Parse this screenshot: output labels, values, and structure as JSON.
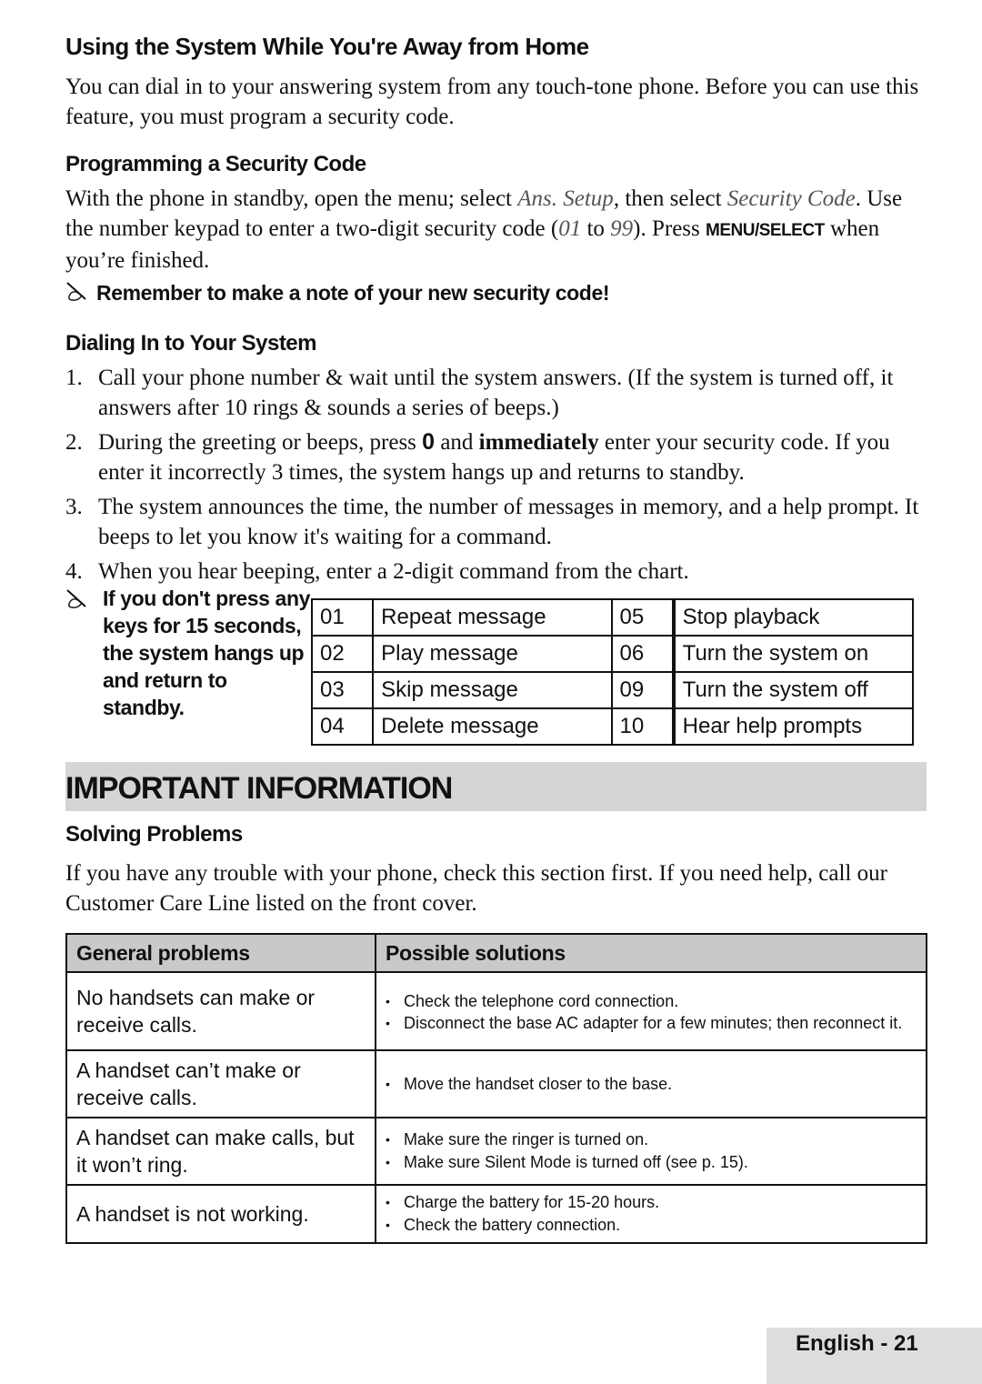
{
  "section1": {
    "title": "Using the System While You're Away from Home",
    "intro": "You can dial in to your answering system from any touch-tone phone. Before you can use this feature, you must program a security code."
  },
  "section2": {
    "title": "Programming a Security Code",
    "text_1": "With the phone in standby, open the menu; select ",
    "menu_ans_setup": "Ans. Setup",
    "text_2": ", then select ",
    "menu_security_code": "Security Code",
    "text_3": ". Use the number keypad to enter a two-digit security code (",
    "range_from": "01",
    "text_4": " to ",
    "range_to": "99",
    "text_5": "). Press ",
    "key_menu_select": "MENU/SELECT",
    "text_6": " when you’re finished.",
    "note": "Remember to make a note of your new security code!",
    "note_icon": "pencil-note-icon"
  },
  "section3": {
    "title": "Dialing In to Your System",
    "steps": [
      {
        "num": "1.",
        "text": "Call your phone number & wait until the system answers. (If the system is turned off, it answers after 10 rings & sounds a series of beeps.)"
      },
      {
        "num": "2.",
        "pre": "During the greeting or beeps, press ",
        "key": "0",
        "mid": " and ",
        "bold": "immediately",
        "post": " enter your security code. If you enter it incorrectly 3 times, the system hangs up and returns to standby."
      },
      {
        "num": "3.",
        "text": "The system announces the time, the number of messages in memory, and a help prompt. It beeps to let you know it's waiting for a command."
      },
      {
        "num": "4.",
        "text": "When you hear beeping, enter a 2-digit command from the chart."
      }
    ],
    "side_note": "If you don't press any keys for 15 seconds, the system hangs up and return to standby.",
    "side_note_icon": "pencil-note-icon",
    "commands": [
      {
        "code_a": "01",
        "desc_a": "Repeat message",
        "code_b": "05",
        "desc_b": "Stop playback"
      },
      {
        "code_a": "02",
        "desc_a": "Play message",
        "code_b": "06",
        "desc_b": "Turn the system on"
      },
      {
        "code_a": "03",
        "desc_a": "Skip message",
        "code_b": "09",
        "desc_b": "Turn the system off"
      },
      {
        "code_a": "04",
        "desc_a": "Delete message",
        "code_b": "10",
        "desc_b": "Hear help prompts"
      }
    ]
  },
  "banner": {
    "title": "IMPORTANT INFORMATION",
    "bg_color": "#d4d5d7"
  },
  "section4": {
    "title": "Solving Problems",
    "intro": "If you have any trouble with your phone, check this section first. If you need help, call our Customer Care Line listed on the front cover.",
    "table": {
      "headers": [
        "General problems",
        "Possible solutions"
      ],
      "rows": [
        {
          "problem": "No handsets can make or receive calls.",
          "solutions": [
            "Check the telephone cord connection.",
            "Disconnect the base AC adapter for a few minutes; then reconnect it."
          ]
        },
        {
          "problem": "A handset can’t make or receive calls.",
          "solutions": [
            "Move the handset closer to the base."
          ]
        },
        {
          "problem": "A handset can make calls, but it won’t ring.",
          "solutions": [
            "Make sure the ringer is turned on.",
            "Make sure Silent Mode is turned off (see p. 15)."
          ]
        },
        {
          "problem": "A handset is not working.",
          "solutions": [
            "Charge the battery for 15-20 hours.",
            "Check the battery connection."
          ]
        }
      ]
    }
  },
  "footer": {
    "page_label": "English - 21"
  }
}
